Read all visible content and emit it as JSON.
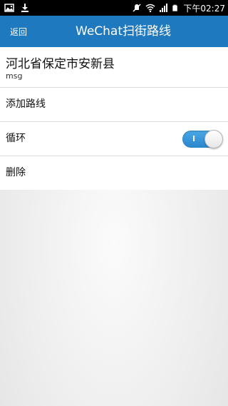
{
  "status_bar": {
    "time": "下午02:27",
    "icons": [
      "image-icon",
      "download-icon",
      "mute-icon",
      "wifi-icon",
      "signal-icon",
      "battery-icon"
    ]
  },
  "app_bar": {
    "back_label": "返回",
    "title": "WeChat扫街路线",
    "color": "#1f79bf"
  },
  "location": {
    "title": "河北省保定市安新县",
    "subtitle": "msg"
  },
  "menu": {
    "add_route": "添加路线",
    "loop": "循环",
    "loop_toggle_mark": "I",
    "loop_enabled": true,
    "delete": "删除"
  },
  "colors": {
    "toggle_on": "#3497dc"
  }
}
